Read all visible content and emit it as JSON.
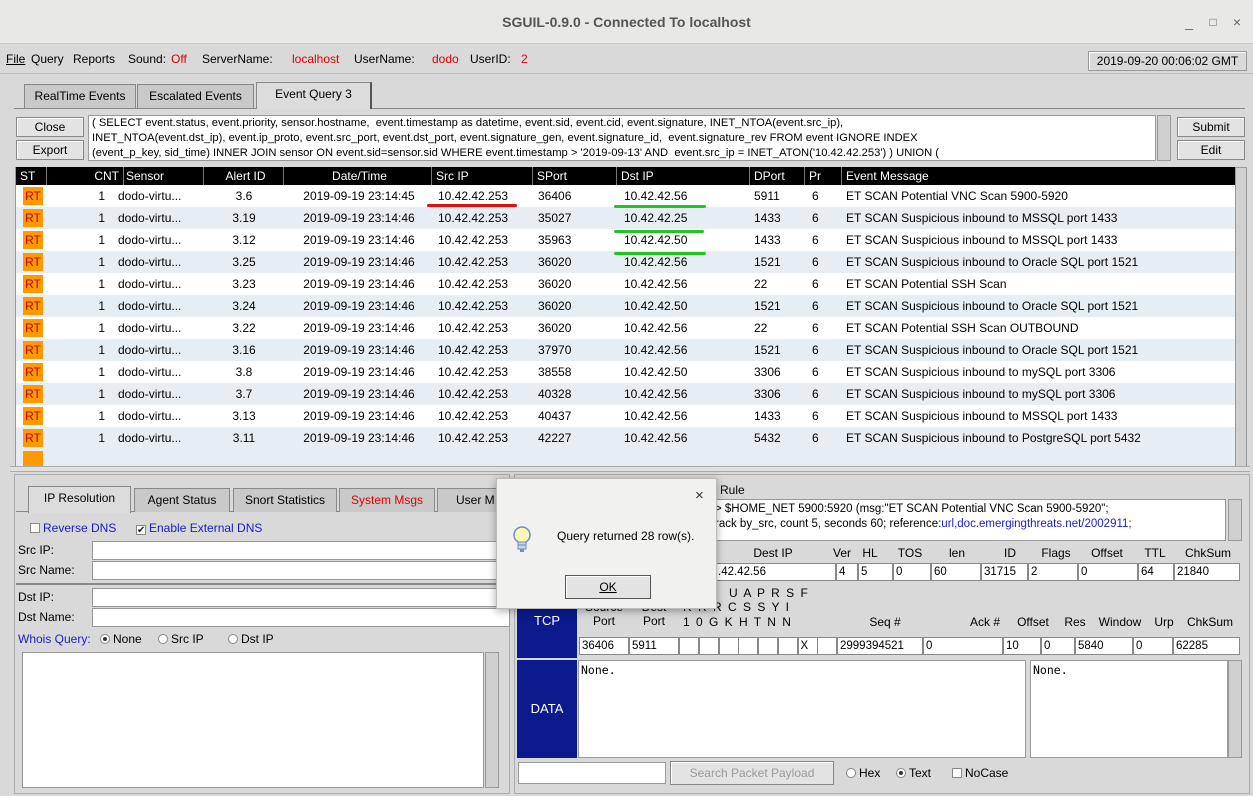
{
  "window": {
    "title": "SGUIL-0.9.0 - Connected To localhost",
    "minimize": "_",
    "maximize": "□",
    "close": "×"
  },
  "menubar": {
    "file": "File",
    "query": "Query",
    "reports": "Reports",
    "sound_label": "Sound:",
    "sound_value": "Off",
    "server_label": "ServerName:",
    "server_value": "localhost",
    "user_label": "UserName:",
    "user_value": "dodo",
    "userid_label": "UserID:",
    "userid_value": "2",
    "clock": "2019-09-20 00:06:02 GMT"
  },
  "tabs": [
    "RealTime Events",
    "Escalated Events",
    "Event Query 3"
  ],
  "query_panel": {
    "close": "Close",
    "export": "Export",
    "submit": "Submit",
    "edit": "Edit",
    "sql_lines": [
      "( SELECT event.status, event.priority, sensor.hostname,  event.timestamp as datetime, event.sid, event.cid, event.signature, INET_NTOA(event.src_ip),",
      "INET_NTOA(event.dst_ip), event.ip_proto, event.src_port, event.dst_port, event.signature_gen, event.signature_id,  event.signature_rev FROM event IGNORE INDEX",
      "(event_p_key, sid_time) INNER JOIN sensor ON event.sid=sensor.sid WHERE event.timestamp > '2019-09-13' AND  event.src_ip = INET_ATON('10.42.42.253') ) UNION ("
    ]
  },
  "grid": {
    "columns": [
      "ST",
      "CNT",
      "Sensor",
      "Alert ID",
      "Date/Time",
      "Src IP",
      "SPort",
      "Dst IP",
      "DPort",
      "Pr",
      "Event Message"
    ],
    "rows": [
      {
        "st": "RT",
        "cnt": "1",
        "sensor": "dodo-virtu...",
        "alert": "3.6",
        "dt": "2019-09-19 23:14:45",
        "src": "10.42.42.253",
        "sport": "36406",
        "dst": "10.42.42.56",
        "dport": "5911",
        "pr": "6",
        "msg": "ET SCAN Potential VNC Scan 5900-5920"
      },
      {
        "st": "RT",
        "cnt": "1",
        "sensor": "dodo-virtu...",
        "alert": "3.19",
        "dt": "2019-09-19 23:14:46",
        "src": "10.42.42.253",
        "sport": "35027",
        "dst": "10.42.42.25",
        "dport": "1433",
        "pr": "6",
        "msg": "ET SCAN Suspicious inbound to MSSQL port 1433"
      },
      {
        "st": "RT",
        "cnt": "1",
        "sensor": "dodo-virtu...",
        "alert": "3.12",
        "dt": "2019-09-19 23:14:46",
        "src": "10.42.42.253",
        "sport": "35963",
        "dst": "10.42.42.50",
        "dport": "1433",
        "pr": "6",
        "msg": "ET SCAN Suspicious inbound to MSSQL port 1433"
      },
      {
        "st": "RT",
        "cnt": "1",
        "sensor": "dodo-virtu...",
        "alert": "3.25",
        "dt": "2019-09-19 23:14:46",
        "src": "10.42.42.253",
        "sport": "36020",
        "dst": "10.42.42.56",
        "dport": "1521",
        "pr": "6",
        "msg": "ET SCAN Suspicious inbound to Oracle SQL port 1521"
      },
      {
        "st": "RT",
        "cnt": "1",
        "sensor": "dodo-virtu...",
        "alert": "3.23",
        "dt": "2019-09-19 23:14:46",
        "src": "10.42.42.253",
        "sport": "36020",
        "dst": "10.42.42.56",
        "dport": "22",
        "pr": "6",
        "msg": "ET SCAN Potential SSH Scan"
      },
      {
        "st": "RT",
        "cnt": "1",
        "sensor": "dodo-virtu...",
        "alert": "3.24",
        "dt": "2019-09-19 23:14:46",
        "src": "10.42.42.253",
        "sport": "36020",
        "dst": "10.42.42.50",
        "dport": "1521",
        "pr": "6",
        "msg": "ET SCAN Suspicious inbound to Oracle SQL port 1521"
      },
      {
        "st": "RT",
        "cnt": "1",
        "sensor": "dodo-virtu...",
        "alert": "3.22",
        "dt": "2019-09-19 23:14:46",
        "src": "10.42.42.253",
        "sport": "36020",
        "dst": "10.42.42.56",
        "dport": "22",
        "pr": "6",
        "msg": "ET SCAN Potential SSH Scan OUTBOUND"
      },
      {
        "st": "RT",
        "cnt": "1",
        "sensor": "dodo-virtu...",
        "alert": "3.16",
        "dt": "2019-09-19 23:14:46",
        "src": "10.42.42.253",
        "sport": "37970",
        "dst": "10.42.42.56",
        "dport": "1521",
        "pr": "6",
        "msg": "ET SCAN Suspicious inbound to Oracle SQL port 1521"
      },
      {
        "st": "RT",
        "cnt": "1",
        "sensor": "dodo-virtu...",
        "alert": "3.8",
        "dt": "2019-09-19 23:14:46",
        "src": "10.42.42.253",
        "sport": "38558",
        "dst": "10.42.42.50",
        "dport": "3306",
        "pr": "6",
        "msg": "ET SCAN Suspicious inbound to mySQL port 3306"
      },
      {
        "st": "RT",
        "cnt": "1",
        "sensor": "dodo-virtu...",
        "alert": "3.7",
        "dt": "2019-09-19 23:14:46",
        "src": "10.42.42.253",
        "sport": "40328",
        "dst": "10.42.42.56",
        "dport": "3306",
        "pr": "6",
        "msg": "ET SCAN Suspicious inbound to mySQL port 3306"
      },
      {
        "st": "RT",
        "cnt": "1",
        "sensor": "dodo-virtu...",
        "alert": "3.13",
        "dt": "2019-09-19 23:14:46",
        "src": "10.42.42.253",
        "sport": "40437",
        "dst": "10.42.42.56",
        "dport": "1433",
        "pr": "6",
        "msg": "ET SCAN Suspicious inbound to MSSQL port 1433"
      },
      {
        "st": "RT",
        "cnt": "1",
        "sensor": "dodo-virtu...",
        "alert": "3.11",
        "dt": "2019-09-19 23:14:46",
        "src": "10.42.42.253",
        "sport": "42227",
        "dst": "10.42.42.56",
        "dport": "5432",
        "pr": "6",
        "msg": "ET SCAN Suspicious inbound to PostgreSQL port 5432"
      }
    ]
  },
  "lower_tabs": [
    "IP Resolution",
    "Agent Status",
    "Snort Statistics",
    "System Msgs",
    "User M"
  ],
  "ip_resolution": {
    "reverse_dns": "Reverse DNS",
    "external_dns": "Enable External DNS",
    "src_ip": "Src IP:",
    "src_name": "Src Name:",
    "dst_ip": "Dst IP:",
    "dst_name": "Dst Name:",
    "whois": "Whois Query:",
    "opt_none": "None",
    "opt_src": "Src IP",
    "opt_dst": "Dst IP"
  },
  "rule": {
    "header": "Rule",
    "line1": "> $HOME_NET 5900:5920 (msg:\"ET SCAN Potential VNC Scan 5900-5920\";",
    "line2_prefix": "rack by_src, count 5, seconds 60; reference:",
    "line2_link": "url,doc.emergingthreats.net/2002911;"
  },
  "ip_header": {
    "labels": [
      "Dest IP",
      "Ver",
      "HL",
      "TOS",
      "len",
      "ID",
      "Flags",
      "Offset",
      "TTL",
      "ChkSum"
    ],
    "values": [
      ".42.42.56",
      "4",
      "5",
      "0",
      "60",
      "31715",
      "2",
      "0",
      "64",
      "21840"
    ]
  },
  "tcp": {
    "label": "TCP",
    "hdr_source": "Source\nPort",
    "hdr_dest": "Dest\nPort",
    "flag_rows": [
      "U A P R S F",
      "R R R C S S Y I",
      "1 0 G K H T N N"
    ],
    "seq_label": "Seq #",
    "ack_label": "Ack #",
    "offset_label": "Offset",
    "res_label": "Res",
    "window_label": "Window",
    "urp_label": "Urp",
    "chksum_label": "ChkSum",
    "src_port": "36406",
    "dst_port": "5911",
    "syn_flag": "X",
    "seq": "2999394521",
    "ack": "0",
    "offset": "10",
    "res": "0",
    "window": "5840",
    "urp": "0",
    "chksum": "62285"
  },
  "data_panel": {
    "label": "DATA",
    "hex": "None.",
    "ascii": "None."
  },
  "search": {
    "button": "Search Packet Payload",
    "hex": "Hex",
    "text": "Text",
    "nocase": "NoCase"
  },
  "dialog": {
    "message": "Query returned 28 row(s).",
    "ok": "OK",
    "close": "×"
  }
}
